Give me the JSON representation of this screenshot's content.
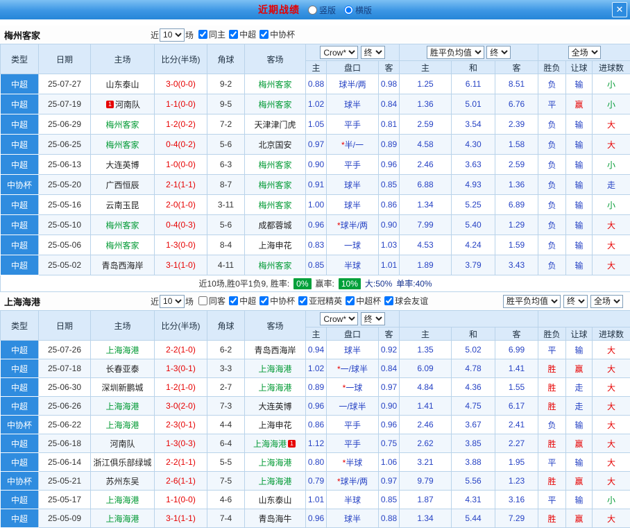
{
  "titlebar": {
    "title": "近期战绩",
    "layout_options": [
      {
        "label": "竖版",
        "selected": false
      },
      {
        "label": "横版",
        "selected": true
      }
    ],
    "close_icon": "✕"
  },
  "columns": {
    "type": "类型",
    "date": "日期",
    "home": "主场",
    "score": "比分(半场)",
    "corners": "角球",
    "away": "客场",
    "odds_home": "主",
    "handicap": "盘口",
    "odds_away": "客",
    "win": "主",
    "draw": "和",
    "lose": "客",
    "result": "胜负",
    "give": "让球",
    "goals": "进球数"
  },
  "colors": {
    "type_cell": "#2f8cdf",
    "focus_team": "#009933",
    "red": "#e60000",
    "blue": "#2743c4",
    "badge_bg": "#00a03a",
    "border": "#b9d3ea",
    "header_bg": "#daeafa",
    "titlebar_top": "#7cc0f4",
    "titlebar_bottom": "#2585d8"
  },
  "sections": [
    {
      "team": "梅州客家",
      "filter": {
        "near": "近",
        "count": "10",
        "games": "场",
        "checkboxes": [
          {
            "label": "同主",
            "checked": true
          },
          {
            "label": "中超",
            "checked": true
          },
          {
            "label": "中协杯",
            "checked": true
          }
        ]
      },
      "selects": {
        "company": "Crow*",
        "company_state": "终",
        "europe": "胜平负均值",
        "europe_state": "终",
        "scope": "全场"
      },
      "rows": [
        {
          "type": "中超",
          "date": "25-07-27",
          "home": "山东泰山",
          "score": "3-0(0-0)",
          "corners": "9-2",
          "away": "梅州客家",
          "odds_h": "0.88",
          "handicap": "球半/两",
          "odds_a": "0.98",
          "win": "1.25",
          "draw": "6.11",
          "lose": "8.51",
          "result": "负",
          "give": "输",
          "goals": "小"
        },
        {
          "type": "中超",
          "date": "25-07-19",
          "home": "河南队",
          "home_badge": "1",
          "home_badge_pos": "before",
          "score": "1-1(0-0)",
          "corners": "9-5",
          "away": "梅州客家",
          "odds_h": "1.02",
          "handicap": "球半",
          "odds_a": "0.84",
          "win": "1.36",
          "draw": "5.01",
          "lose": "6.76",
          "result": "平",
          "give": "赢",
          "goals": "小"
        },
        {
          "type": "中超",
          "date": "25-06-29",
          "home": "梅州客家",
          "score": "1-2(0-2)",
          "corners": "7-2",
          "away": "天津津门虎",
          "odds_h": "1.05",
          "handicap": "平手",
          "odds_a": "0.81",
          "win": "2.59",
          "draw": "3.54",
          "lose": "2.39",
          "result": "负",
          "give": "输",
          "goals": "大"
        },
        {
          "type": "中超",
          "date": "25-06-25",
          "home": "梅州客家",
          "score": "0-4(0-2)",
          "corners": "5-6",
          "away": "北京国安",
          "odds_h": "0.97",
          "handicap": "*半/一",
          "odds_a": "0.89",
          "win": "4.58",
          "draw": "4.30",
          "lose": "1.58",
          "result": "负",
          "give": "输",
          "goals": "大"
        },
        {
          "type": "中超",
          "date": "25-06-13",
          "home": "大连英博",
          "score": "1-0(0-0)",
          "corners": "6-3",
          "away": "梅州客家",
          "odds_h": "0.90",
          "handicap": "平手",
          "odds_a": "0.96",
          "win": "2.46",
          "draw": "3.63",
          "lose": "2.59",
          "result": "负",
          "give": "输",
          "goals": "小"
        },
        {
          "type": "中协杯",
          "date": "25-05-20",
          "home": "广西恒辰",
          "score": "2-1(1-1)",
          "corners": "8-7",
          "away": "梅州客家",
          "odds_h": "0.91",
          "handicap": "球半",
          "odds_a": "0.85",
          "win": "6.88",
          "draw": "4.93",
          "lose": "1.36",
          "result": "负",
          "give": "输",
          "goals": "走"
        },
        {
          "type": "中超",
          "date": "25-05-16",
          "home": "云南玉昆",
          "score": "2-0(1-0)",
          "corners": "3-11",
          "away": "梅州客家",
          "odds_h": "1.00",
          "handicap": "球半",
          "odds_a": "0.86",
          "win": "1.34",
          "draw": "5.25",
          "lose": "6.89",
          "result": "负",
          "give": "输",
          "goals": "小"
        },
        {
          "type": "中超",
          "date": "25-05-10",
          "home": "梅州客家",
          "score": "0-4(0-3)",
          "corners": "5-6",
          "away": "成都蓉城",
          "odds_h": "0.96",
          "handicap": "*球半/两",
          "odds_a": "0.90",
          "win": "7.99",
          "draw": "5.40",
          "lose": "1.29",
          "result": "负",
          "give": "输",
          "goals": "大"
        },
        {
          "type": "中超",
          "date": "25-05-06",
          "home": "梅州客家",
          "score": "1-3(0-0)",
          "corners": "8-4",
          "away": "上海申花",
          "odds_h": "0.83",
          "handicap": "一球",
          "odds_a": "1.03",
          "win": "4.53",
          "draw": "4.24",
          "lose": "1.59",
          "result": "负",
          "give": "输",
          "goals": "大"
        },
        {
          "type": "中超",
          "date": "25-05-02",
          "home": "青岛西海岸",
          "score": "3-1(1-0)",
          "corners": "4-11",
          "away": "梅州客家",
          "odds_h": "0.85",
          "handicap": "半球",
          "odds_a": "1.01",
          "win": "1.89",
          "draw": "3.79",
          "lose": "3.43",
          "result": "负",
          "give": "输",
          "goals": "大"
        }
      ],
      "summary": {
        "prefix": "近10场,胜0平1负9, 胜率:",
        "win_rate": "0%",
        "mid": "赢率:",
        "give_rate": "10%",
        "big": "大:50%",
        "single": "单率:40%"
      }
    },
    {
      "team": "上海海港",
      "filter": {
        "near": "近",
        "count": "10",
        "games": "场",
        "checkboxes": [
          {
            "label": "同客",
            "checked": false
          },
          {
            "label": "中超",
            "checked": true
          },
          {
            "label": "中协杯",
            "checked": true
          },
          {
            "label": "亚冠精英",
            "checked": true
          },
          {
            "label": "中超杯",
            "checked": true
          },
          {
            "label": "球会友谊",
            "checked": true
          }
        ]
      },
      "selects": {
        "company": "Crow*",
        "company_state": "终",
        "europe": "胜平负均值",
        "europe_state": "终",
        "scope": "全场"
      },
      "rows": [
        {
          "type": "中超",
          "date": "25-07-26",
          "home": "上海海港",
          "score": "2-2(1-0)",
          "corners": "6-2",
          "away": "青岛西海岸",
          "odds_h": "0.94",
          "handicap": "球半",
          "odds_a": "0.92",
          "win": "1.35",
          "draw": "5.02",
          "lose": "6.99",
          "result": "平",
          "give": "输",
          "goals": "大"
        },
        {
          "type": "中超",
          "date": "25-07-18",
          "home": "长春亚泰",
          "score": "1-3(0-1)",
          "corners": "3-3",
          "away": "上海海港",
          "odds_h": "1.02",
          "handicap": "*一/球半",
          "odds_a": "0.84",
          "win": "6.09",
          "draw": "4.78",
          "lose": "1.41",
          "result": "胜",
          "give": "赢",
          "goals": "大"
        },
        {
          "type": "中超",
          "date": "25-06-30",
          "home": "深圳新鹏城",
          "score": "1-2(1-0)",
          "corners": "2-7",
          "away": "上海海港",
          "odds_h": "0.89",
          "handicap": "*一球",
          "odds_a": "0.97",
          "win": "4.84",
          "draw": "4.36",
          "lose": "1.55",
          "result": "胜",
          "give": "走",
          "goals": "大"
        },
        {
          "type": "中超",
          "date": "25-06-26",
          "home": "上海海港",
          "score": "3-0(2-0)",
          "corners": "7-3",
          "away": "大连英博",
          "odds_h": "0.96",
          "handicap": "一/球半",
          "odds_a": "0.90",
          "win": "1.41",
          "draw": "4.75",
          "lose": "6.17",
          "result": "胜",
          "give": "走",
          "goals": "大"
        },
        {
          "type": "中协杯",
          "date": "25-06-22",
          "home": "上海海港",
          "score": "2-3(0-1)",
          "corners": "4-4",
          "away": "上海申花",
          "odds_h": "0.86",
          "handicap": "平手",
          "odds_a": "0.96",
          "win": "2.46",
          "draw": "3.67",
          "lose": "2.41",
          "result": "负",
          "give": "输",
          "goals": "大"
        },
        {
          "type": "中超",
          "date": "25-06-18",
          "home": "河南队",
          "score": "1-3(0-3)",
          "corners": "6-4",
          "away": "上海海港",
          "away_badge": "1",
          "away_badge_pos": "after",
          "odds_h": "1.12",
          "handicap": "平手",
          "odds_a": "0.75",
          "win": "2.62",
          "draw": "3.85",
          "lose": "2.27",
          "result": "胜",
          "give": "赢",
          "goals": "大"
        },
        {
          "type": "中超",
          "date": "25-06-14",
          "home": "浙江俱乐部绿城",
          "score": "2-2(1-1)",
          "corners": "5-5",
          "away": "上海海港",
          "odds_h": "0.80",
          "handicap": "*半球",
          "odds_a": "1.06",
          "win": "3.21",
          "draw": "3.88",
          "lose": "1.95",
          "result": "平",
          "give": "输",
          "goals": "大"
        },
        {
          "type": "中协杯",
          "date": "25-05-21",
          "home": "苏州东吴",
          "score": "2-6(1-1)",
          "corners": "7-5",
          "away": "上海海港",
          "odds_h": "0.79",
          "handicap": "*球半/两",
          "odds_a": "0.97",
          "win": "9.79",
          "draw": "5.56",
          "lose": "1.23",
          "result": "胜",
          "give": "赢",
          "goals": "大"
        },
        {
          "type": "中超",
          "date": "25-05-17",
          "home": "上海海港",
          "score": "1-1(0-0)",
          "corners": "4-6",
          "away": "山东泰山",
          "odds_h": "1.01",
          "handicap": "半球",
          "odds_a": "0.85",
          "win": "1.87",
          "draw": "4.31",
          "lose": "3.16",
          "result": "平",
          "give": "输",
          "goals": "小"
        },
        {
          "type": "中超",
          "date": "25-05-09",
          "home": "上海海港",
          "score": "3-1(1-1)",
          "corners": "7-4",
          "away": "青岛海牛",
          "odds_h": "0.96",
          "handicap": "球半",
          "odds_a": "0.88",
          "win": "1.34",
          "draw": "5.44",
          "lose": "7.29",
          "result": "胜",
          "give": "赢",
          "goals": "大"
        }
      ]
    }
  ]
}
